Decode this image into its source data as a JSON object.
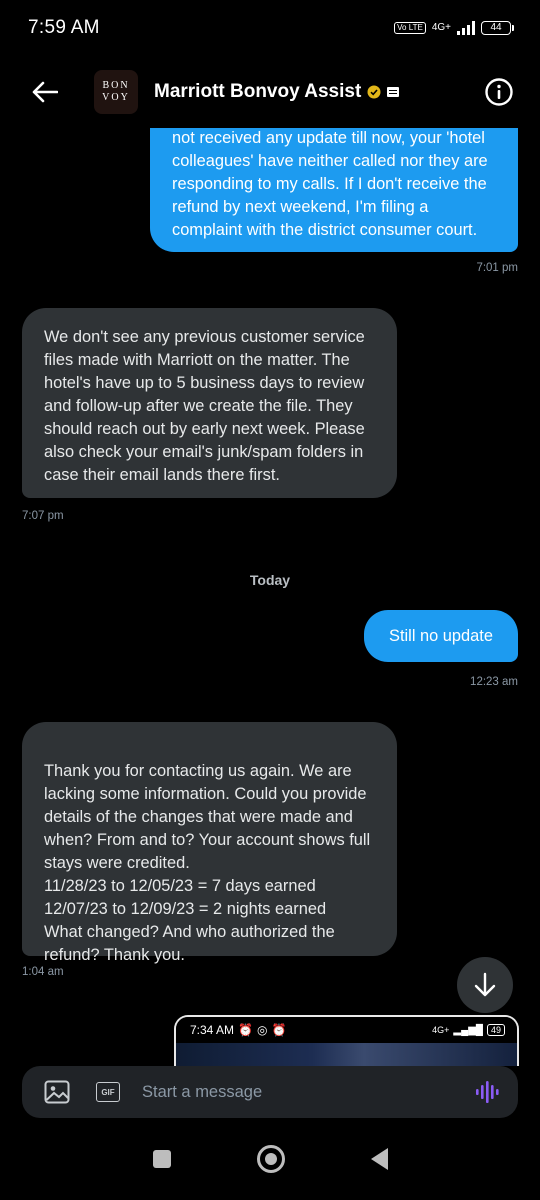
{
  "status_bar": {
    "time": "7:59 AM",
    "volte": "Vo LTE",
    "network": "4G+",
    "battery": "44"
  },
  "header": {
    "logo_line1": "BON",
    "logo_line2": "VOY",
    "title": "Marriott Bonvoy Assist",
    "verified_color": "#e2b719"
  },
  "messages": [
    {
      "id": "m1",
      "side": "out",
      "text": "not received any update till now, your 'hotel colleagues' have neither called nor they are responding to my calls. If I don't receive the refund by next weekend, I'm filing a complaint with the district consumer court.",
      "time": "7:01 pm"
    },
    {
      "id": "m2",
      "side": "in",
      "text": "We don't see any previous customer service files made with Marriott on the matter. The hotel's have up to 5 business days to review and follow-up after we create the file. They should reach out by early next week. Please also check your email's junk/spam folders in case their email lands there first.",
      "time": "7:07 pm"
    },
    {
      "id": "m3",
      "side": "out",
      "text": "Still no update",
      "time": "12:23 am"
    },
    {
      "id": "m4",
      "side": "in",
      "text": "Thank you for contacting us again. We are lacking some information.  Could you provide details of the changes that were made and when? From and to? Your account shows full stays were credited.\n11/28/23 to 12/05/23 = 7 days earned\n12/07/23 to 12/09/23 = 2 nights earned\nWhat changed? And who authorized the refund? Thank you.",
      "time": "1:04 am"
    }
  ],
  "day_separator": "Today",
  "attachment_preview": {
    "time": "7:34 AM",
    "battery": "49",
    "network": "4G+"
  },
  "composer": {
    "placeholder": "Start a message",
    "gif_label": "GIF",
    "voice_color": "#8b5cf6"
  },
  "colors": {
    "accent": "#1d9bf0",
    "incoming_bubble": "#2f3336"
  }
}
